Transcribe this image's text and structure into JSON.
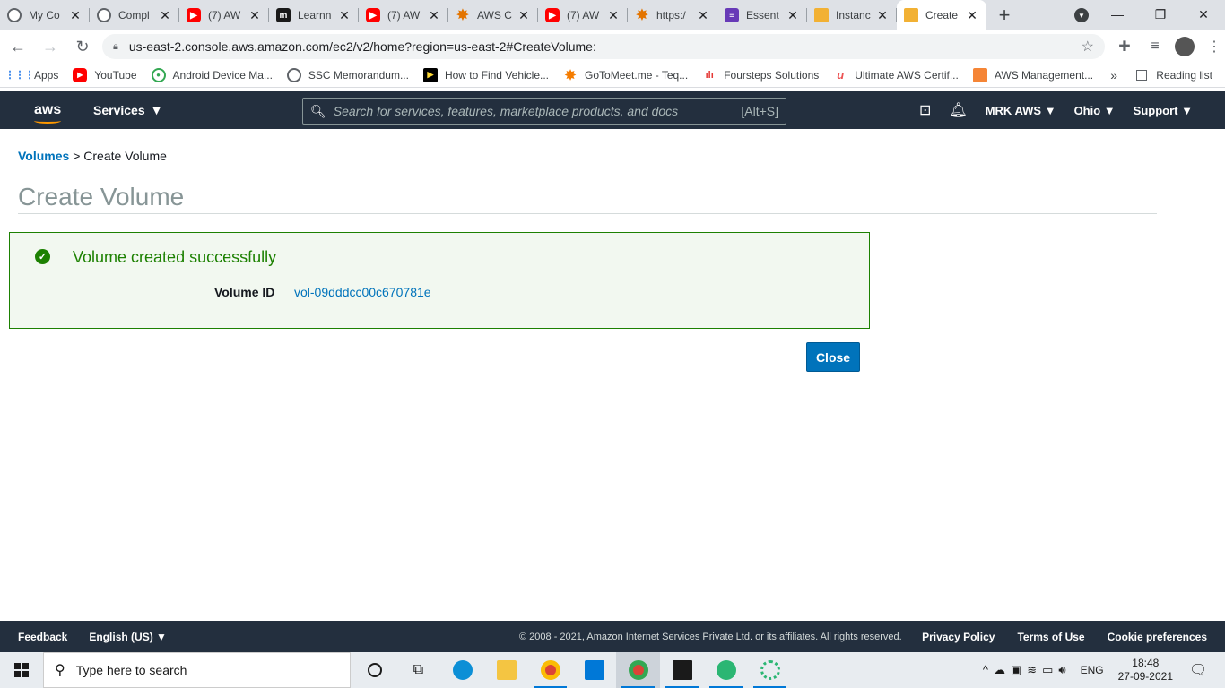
{
  "browser": {
    "tabs": [
      {
        "title": "My Co",
        "favicon": "globe-icon"
      },
      {
        "title": "Compl",
        "favicon": "globe-icon"
      },
      {
        "title": "(7) AW",
        "favicon": "youtube-icon"
      },
      {
        "title": "Learnn",
        "favicon": "m-icon"
      },
      {
        "title": "(7) AW",
        "favicon": "youtube-icon"
      },
      {
        "title": "AWS C",
        "favicon": "star-icon"
      },
      {
        "title": "(7) AW",
        "favicon": "youtube-icon"
      },
      {
        "title": "https:/",
        "favicon": "star-icon"
      },
      {
        "title": "Essent",
        "favicon": "list-icon"
      },
      {
        "title": "Instanc",
        "favicon": "box-icon"
      },
      {
        "title": "Create",
        "favicon": "box-icon",
        "active": true
      }
    ],
    "url": "us-east-2.console.aws.amazon.com/ec2/v2/home?region=us-east-2#CreateVolume:",
    "bookmarks": [
      {
        "label": "Apps",
        "icon": "apps-grid-icon"
      },
      {
        "label": "YouTube",
        "icon": "youtube-icon"
      },
      {
        "label": "Android Device Ma...",
        "icon": "android-icon"
      },
      {
        "label": "SSC Memorandum...",
        "icon": "globe-icon"
      },
      {
        "label": "How to Find Vehicle...",
        "icon": "play-icon"
      },
      {
        "label": "GoToMeet.me - Teq...",
        "icon": "star-icon"
      },
      {
        "label": "Foursteps Solutions",
        "icon": "bar-icon"
      },
      {
        "label": "Ultimate AWS Certif...",
        "icon": "u-icon"
      },
      {
        "label": "AWS Management...",
        "icon": "box-icon"
      }
    ],
    "bookmarks_more": "»",
    "reading_list": "Reading list"
  },
  "aws_header": {
    "logo": "aws",
    "services": "Services",
    "search_placeholder": "Search for services, features, marketplace products, and docs",
    "search_shortcut": "[Alt+S]",
    "account": "MRK AWS",
    "region": "Ohio",
    "support": "Support"
  },
  "page": {
    "breadcrumb_link": "Volumes",
    "breadcrumb_sep": ">",
    "breadcrumb_current": "Create Volume",
    "title": "Create Volume",
    "alert_message": "Volume created successfully",
    "volume_id_label": "Volume ID",
    "volume_id": "vol-09dddcc00c670781e",
    "close_button": "Close"
  },
  "footer": {
    "feedback": "Feedback",
    "language": "English (US)",
    "copyright": "© 2008 - 2021, Amazon Internet Services Private Ltd. or its affiliates. All rights reserved.",
    "privacy": "Privacy Policy",
    "terms": "Terms of Use",
    "cookies": "Cookie preferences"
  },
  "taskbar": {
    "search_placeholder": "Type here to search",
    "language": "ENG",
    "time": "18:48",
    "date": "27-09-2021"
  },
  "colors": {
    "aws_nav": "#232f3e",
    "success_green": "#1d8102",
    "link_blue": "#0073bb"
  }
}
